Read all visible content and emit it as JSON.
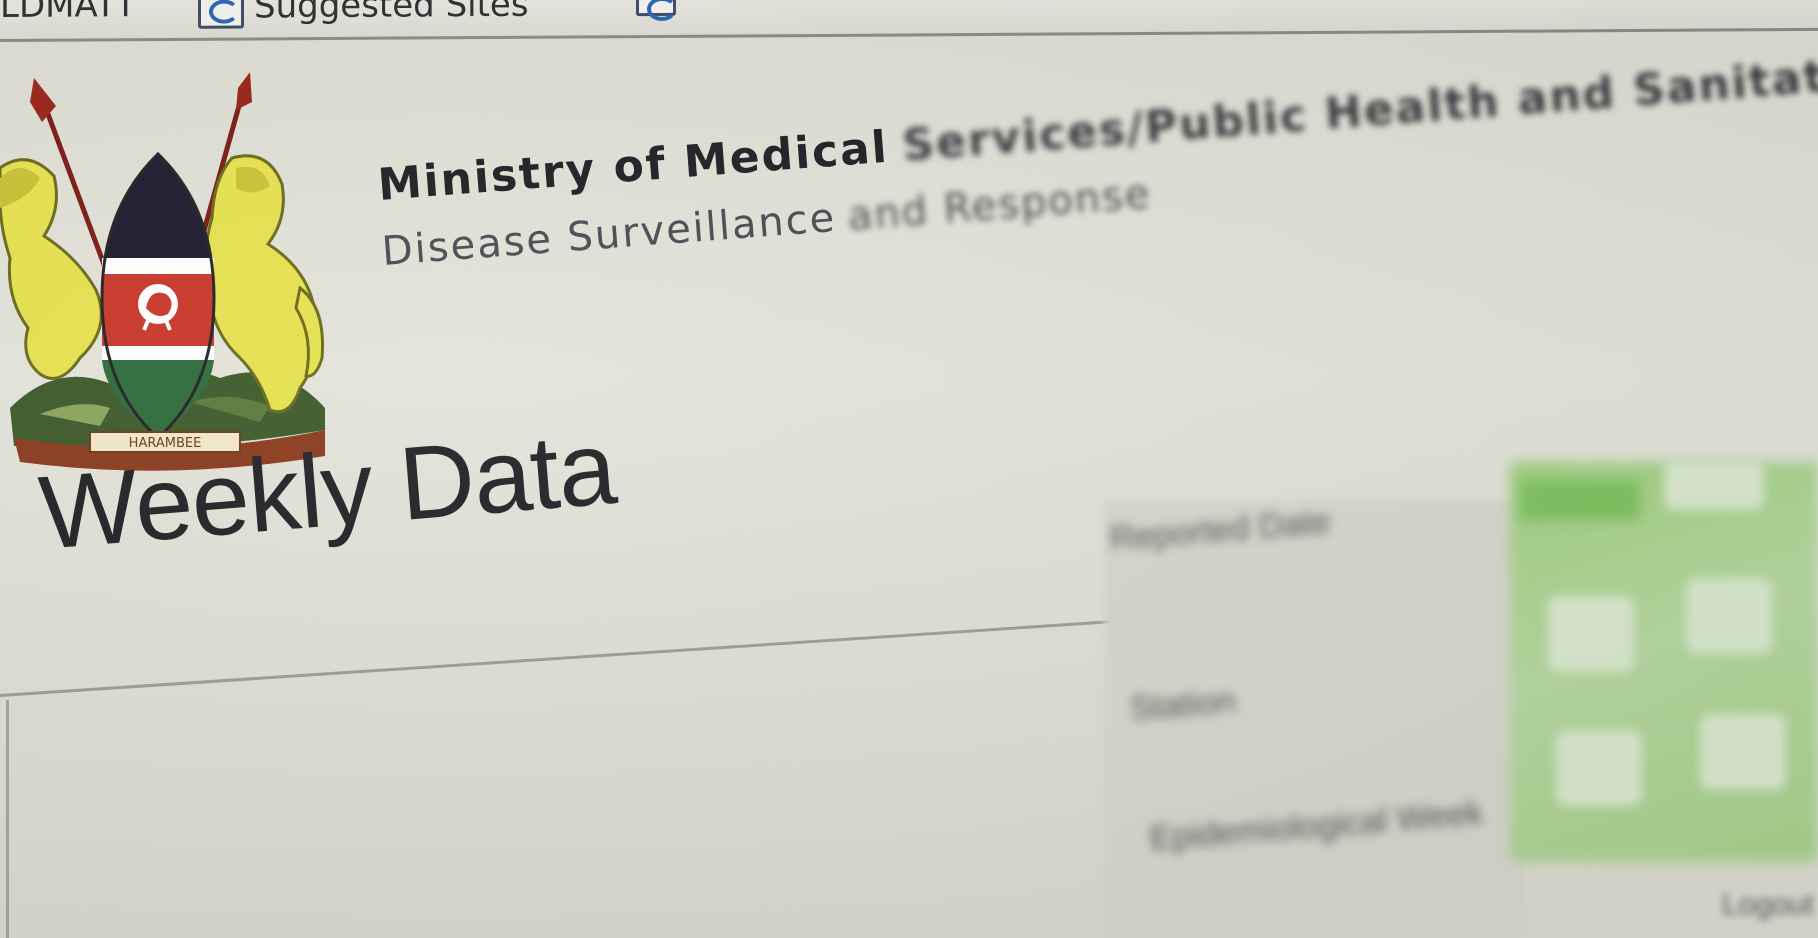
{
  "favorites_bar": {
    "left_item_label": "LDMATT",
    "suggested_sites_label": "Suggested Sites",
    "right_item_label": ""
  },
  "header": {
    "ministry_title": "Ministry of Medical",
    "ministry_title_continued": "Services/Public Health and Sanitation",
    "department": "Disease Surveillance",
    "department_continued": "and Response",
    "emblem_motto": "HARAMBEE"
  },
  "page": {
    "title": "Weekly Data"
  },
  "form": {
    "field_1_label": "Reported Date",
    "field_2_label": "Station",
    "field_3_label": "Epidemiological Week"
  },
  "corner_link": "Logout",
  "colors": {
    "kenya_black": "#1b1b2e",
    "kenya_red": "#c8362a",
    "kenya_green": "#2d6a3a",
    "lion_yellow": "#e6e14e",
    "panel_green": "#a6cf8c"
  }
}
